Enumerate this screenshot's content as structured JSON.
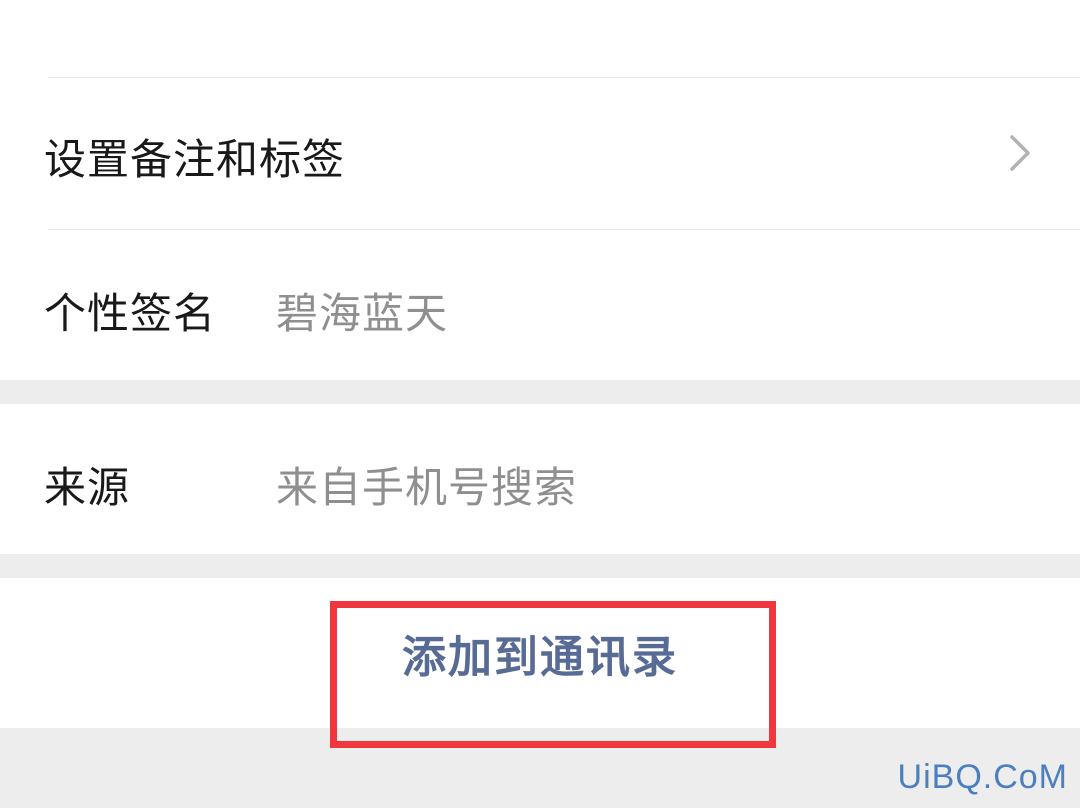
{
  "profile_rows": {
    "remark": {
      "label": "设置备注和标签",
      "icon": "chevron-right-icon"
    },
    "signature": {
      "label": "个性签名",
      "value": "碧海蓝天"
    },
    "source": {
      "label": "来源",
      "value": "来自手机号搜索"
    }
  },
  "actions": {
    "add_to_contacts_label": "添加到通讯录"
  },
  "annotation": {
    "highlight_color": "#f0373d"
  },
  "watermark": {
    "text": "UiBQ.CoM"
  },
  "colors": {
    "background": "#ededed",
    "card": "#ffffff",
    "primary_text": "#191919",
    "secondary_text": "#8f8f8f",
    "link_text": "#576b95"
  }
}
